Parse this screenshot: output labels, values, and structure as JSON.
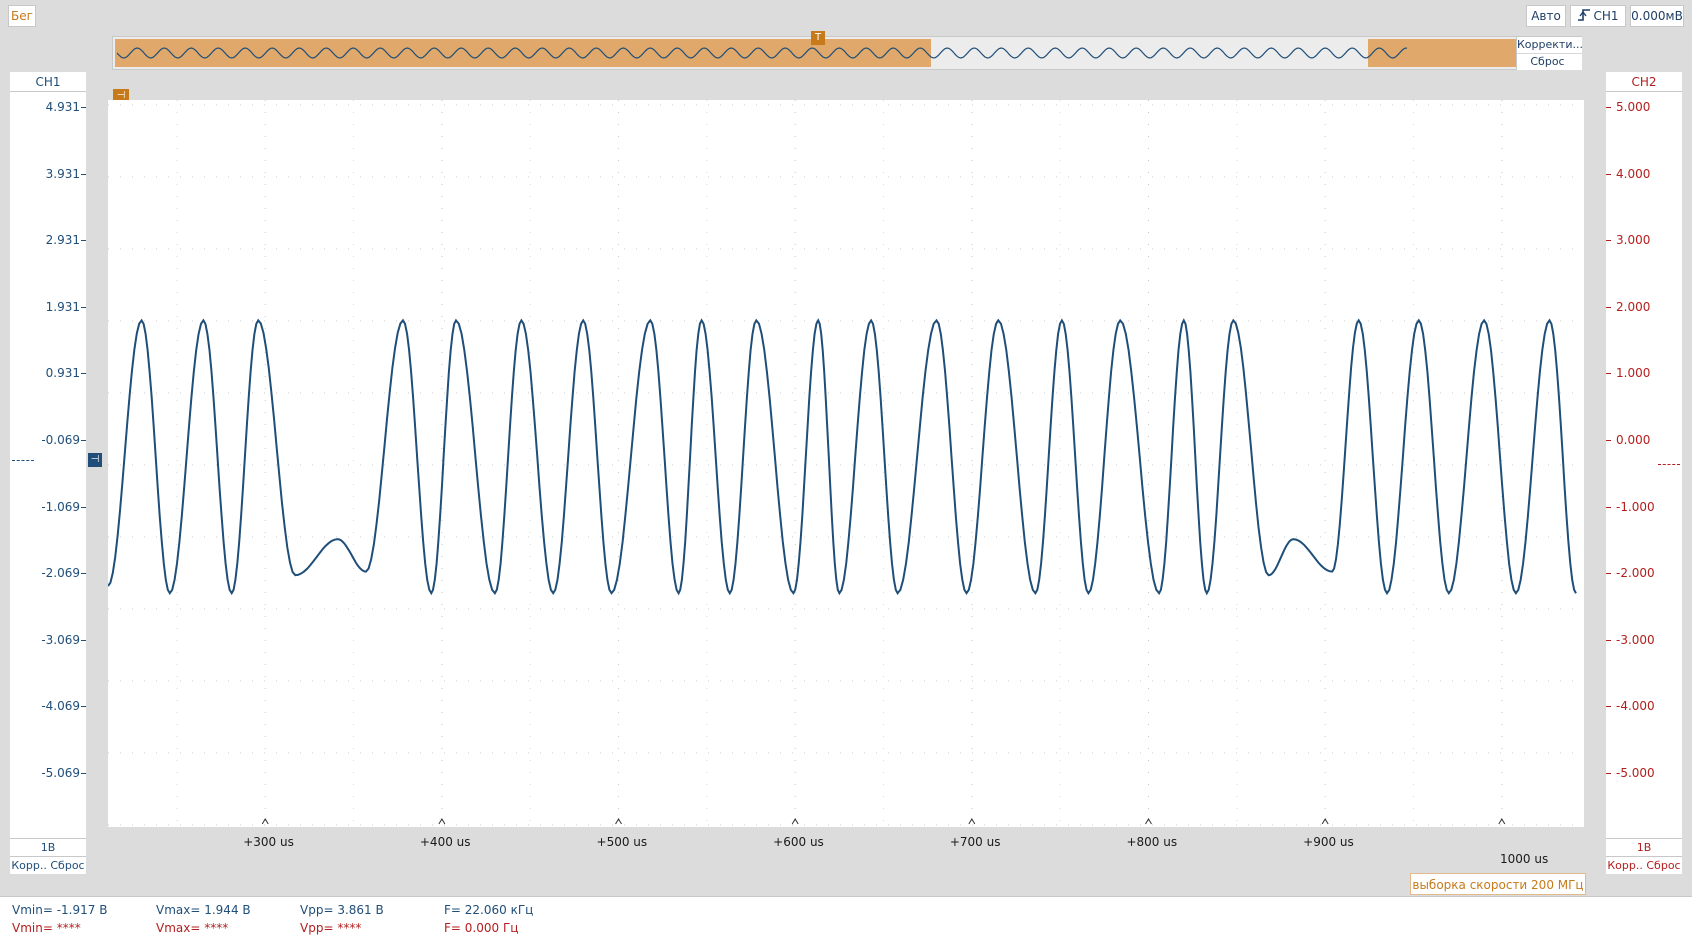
{
  "status": "Бег",
  "trigger": {
    "mode": "Авто",
    "source": "CH1",
    "level": "0.000мВ",
    "edge_icon": "rising-edge-icon"
  },
  "overview": {
    "correct_label": "Корректи...",
    "reset_label": "Сброс"
  },
  "ch1": {
    "label": "CH1",
    "ticks": [
      "4.931",
      "3.931",
      "2.931",
      "1.931",
      "0.931",
      "-0.069",
      "-1.069",
      "-2.069",
      "-3.069",
      "-4.069",
      "-5.069"
    ],
    "scale": "1В",
    "buttons": [
      "Корр..",
      "Сброс"
    ],
    "color": "#1f4e79"
  },
  "ch2": {
    "label": "CH2",
    "ticks": [
      "5.000",
      "4.000",
      "3.000",
      "2.000",
      "1.000",
      "0.000",
      "-1.000",
      "-2.000",
      "-3.000",
      "-4.000",
      "-5.000"
    ],
    "scale": "1В",
    "buttons": [
      "Корр..",
      "Сброс"
    ],
    "color": "#b41e1e"
  },
  "time_axis": {
    "labels": [
      "+300 us",
      "+400 us",
      "+500 us",
      "+600 us",
      "+700 us",
      "+800 us",
      "+900 us"
    ],
    "end_label": "1000 us"
  },
  "sample_rate": "выборка скорости 200 МГц",
  "measurements": {
    "ch1": {
      "vmin": "Vmin= -1.917 В",
      "vmax": "Vmax= 1.944 В",
      "vpp": "Vpp= 3.861 В",
      "freq": "F= 22.060 кГц"
    },
    "ch2": {
      "vmin": "Vmin= ****",
      "vmax": "Vmax= ****",
      "vpp": "Vpp= ****",
      "freq": "F= 0.000 Гц"
    }
  },
  "chart_data": {
    "type": "line",
    "series": [
      {
        "x_us": [
          211,
          230,
          246,
          265,
          281,
          296,
          317,
          341,
          357,
          378,
          394,
          408,
          430,
          445,
          463,
          480,
          496,
          518,
          534,
          547,
          563,
          578,
          599,
          613,
          625,
          643,
          658,
          680,
          697,
          715,
          736,
          751,
          766,
          784,
          806,
          820,
          833,
          848,
          868,
          882,
          904,
          919,
          935,
          953,
          970,
          990,
          1008,
          1027,
          1042
        ],
        "y": [
          -1.75,
          1.94,
          -1.85,
          1.94,
          -1.85,
          1.94,
          -1.6,
          -1.1,
          -1.55,
          1.94,
          -1.85,
          1.94,
          -1.85,
          1.94,
          -1.85,
          1.94,
          -1.85,
          1.94,
          -1.85,
          1.94,
          -1.85,
          1.94,
          -1.85,
          1.94,
          -1.85,
          1.94,
          -1.85,
          1.94,
          -1.85,
          1.94,
          -1.85,
          1.94,
          -1.85,
          1.94,
          -1.85,
          1.94,
          -1.85,
          1.94,
          -1.6,
          -1.1,
          -1.55,
          1.94,
          -1.85,
          1.94,
          -1.85,
          1.94,
          -1.85,
          1.94,
          -1.85
        ]
      }
    ],
    "xlim_us": [
      211,
      1042
    ],
    "ylim": [
      -5.069,
      4.931
    ],
    "grid": true
  }
}
